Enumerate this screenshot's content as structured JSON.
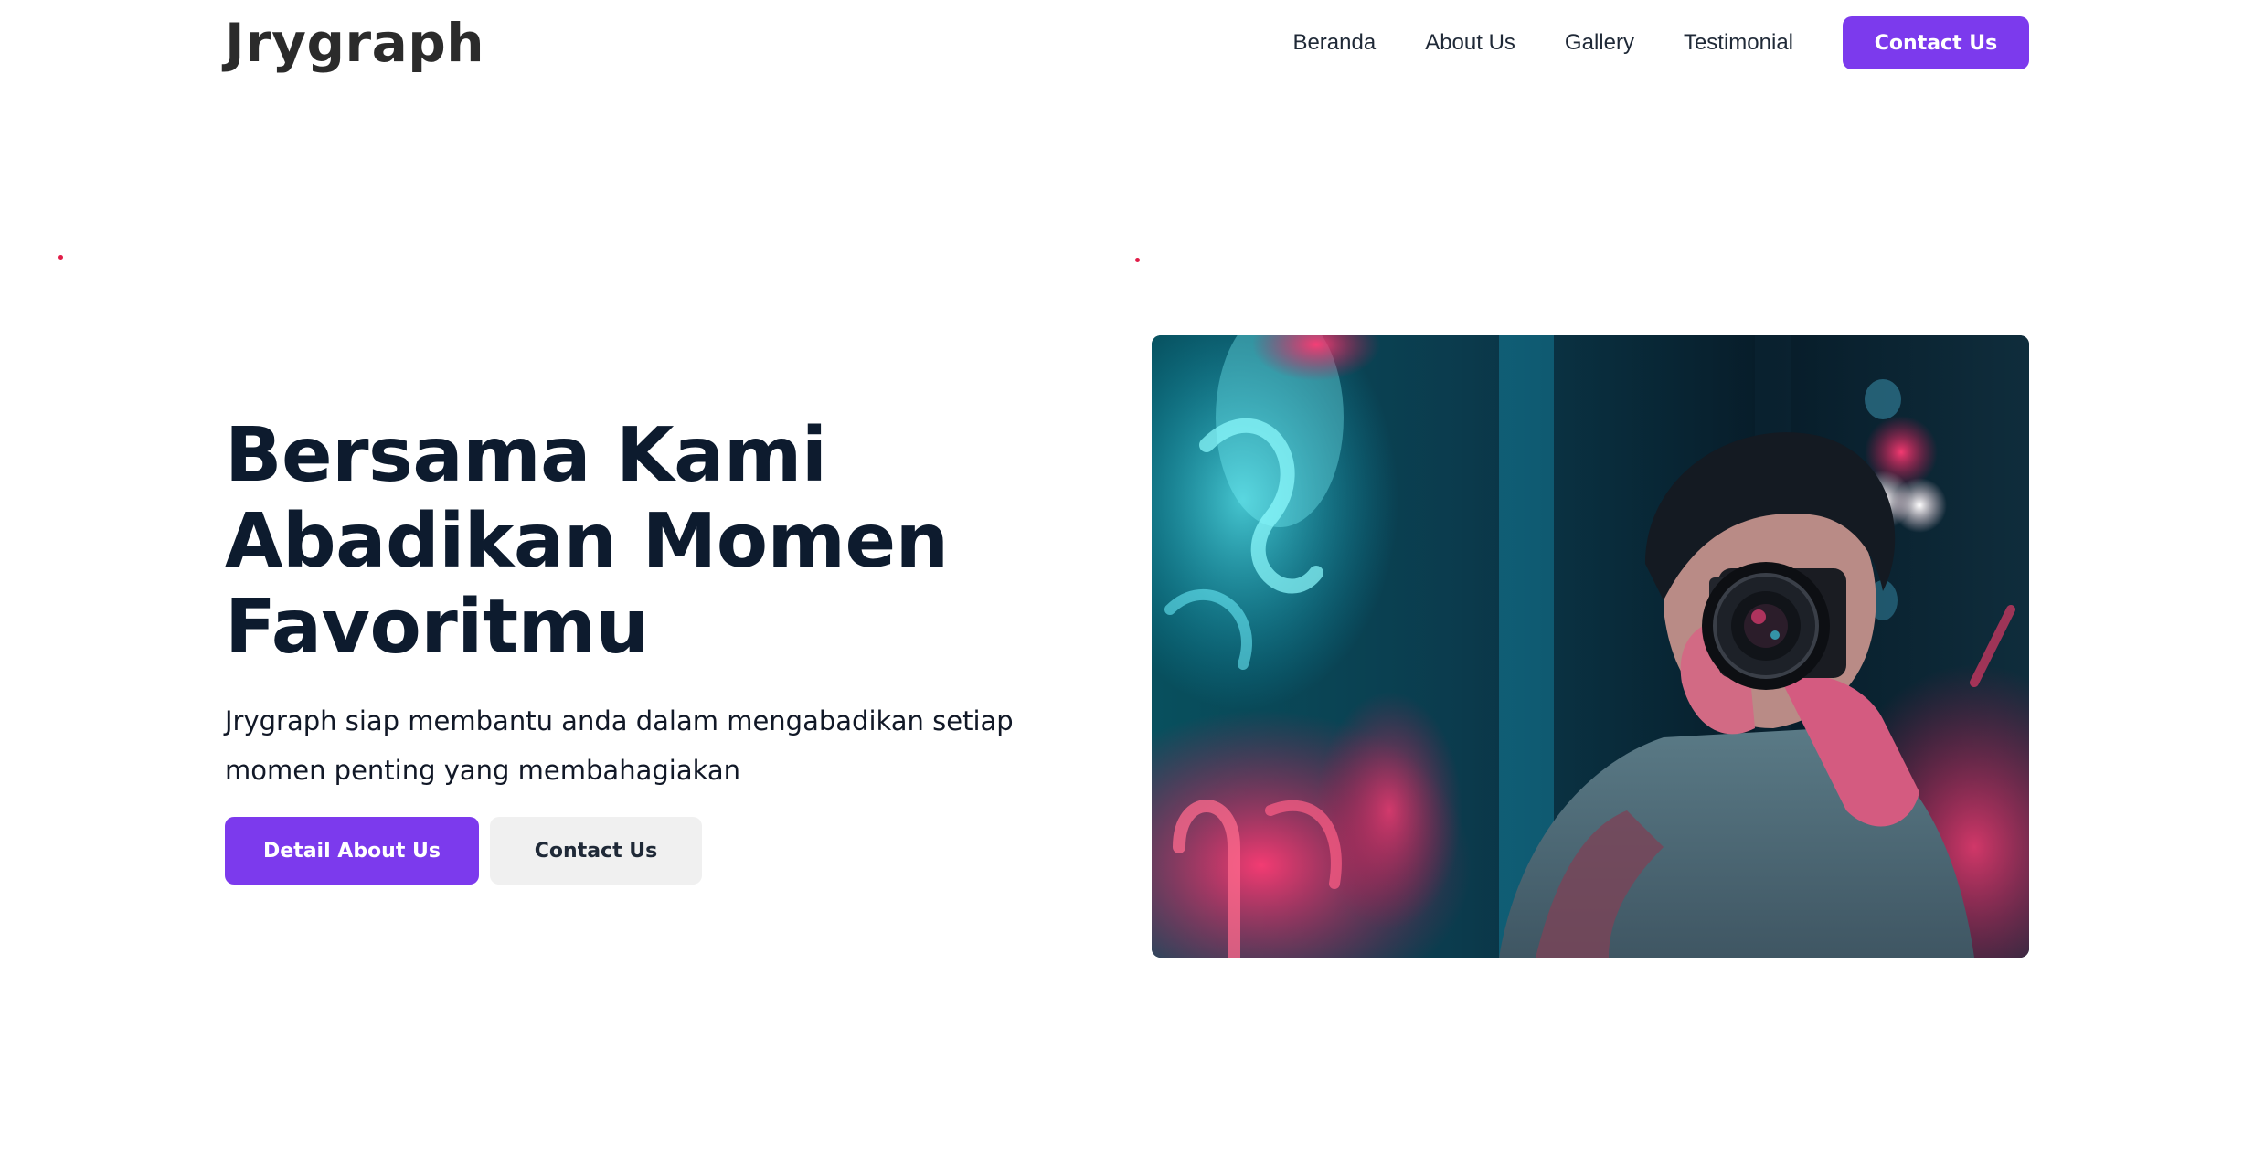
{
  "brand": {
    "name": "Jrygraph"
  },
  "nav": {
    "links": [
      "Beranda",
      "About Us",
      "Gallery",
      "Testimonial"
    ],
    "cta_label": "Contact Us"
  },
  "hero": {
    "title_lines": [
      "Bersama Kami",
      "Abadikan Momen",
      "Favoritmu"
    ],
    "description": "Jrygraph siap membantu anda dalam mengabadikan setiap momen penting yang membahagiakan",
    "primary_button": "Detail About Us",
    "secondary_button": "Contact Us",
    "image_icon": "photographer-neon-photo"
  },
  "colors": {
    "accent": "#7c3aed",
    "heading": "#0d1b2e",
    "secondary_button_bg": "#f0f0f0"
  }
}
